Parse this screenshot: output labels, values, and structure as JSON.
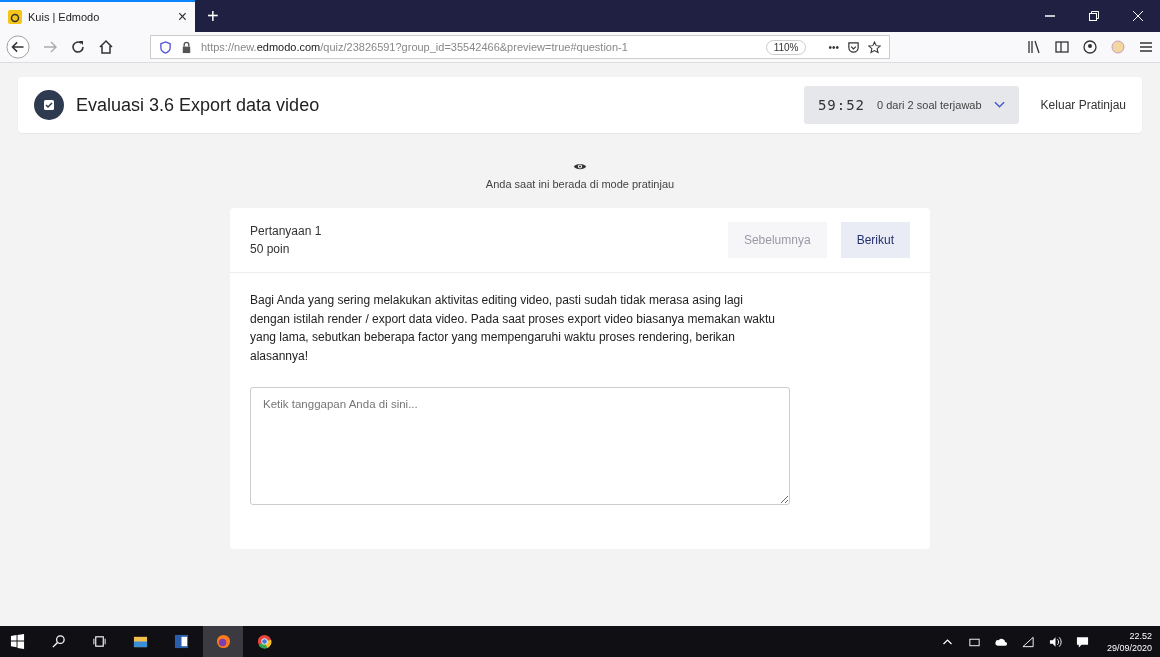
{
  "browser": {
    "tab": {
      "title": "Kuis | Edmodo",
      "close": "×",
      "selected": true
    },
    "new_tab": "+",
    "url": "https://new.**edmodo.com**/quiz/23826591?group_id=35542466&preview=true#question-1",
    "zoom": "110%",
    "more": "•••"
  },
  "header": {
    "title": "Evaluasi 3.6 Export data video",
    "timer": "59:52",
    "progress": "0 dari 2 soal terjawab",
    "exit": "Keluar Pratinjau"
  },
  "preview_notice": "Anda saat ini berada di mode pratinjau",
  "question": {
    "label": "Pertanyaan 1",
    "points": "50 poin",
    "buttons": [
      {
        "label": "Sebelumnya",
        "disabled": true
      },
      {
        "label": "Berikut",
        "disabled": false
      }
    ],
    "text": "Bagi Anda yang sering melakukan aktivitas editing video, pasti sudah tidak merasa asing lagi dengan istilah render / export data video. Pada saat proses export video biasanya memakan waktu yang lama, sebutkan beberapa factor yang mempengaruhi waktu proses rendering, berikan alasannya!",
    "answer": {
      "placeholder": "Ketik tanggapan Anda di sini..."
    }
  },
  "taskbar": {
    "time": "22.52",
    "date": "29/09/2020"
  }
}
